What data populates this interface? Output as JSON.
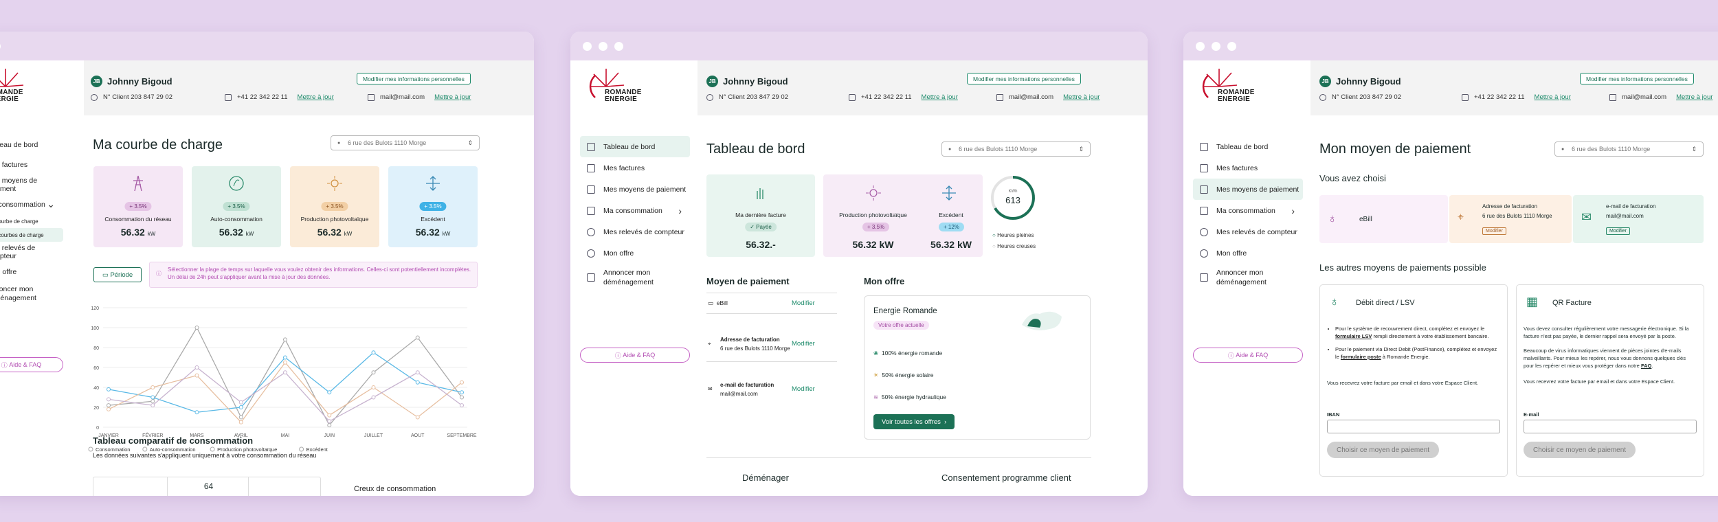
{
  "common": {
    "user_name": "Johnny Bigoud",
    "user_initials": "JB",
    "client_no": "N° Client 203 847 29 02",
    "phone": "+41 22 342 22 11",
    "email": "mail@mail.com",
    "update_link": "Mettre à jour",
    "edit_info": "Modifier mes informations personnelles",
    "address": "6 rue des Bulots 1110 Morge",
    "logo_line1": "ROMANDE",
    "logo_line2": "ENERGIE",
    "help": "Aide & FAQ",
    "accent": "#1c7156",
    "bg": "#e4d3ee"
  },
  "w1": {
    "nav": [
      "Tableau de bord",
      "Mes factures",
      "Mes moyens de paiement",
      "Ma consommation",
      "Ma courbe de charge",
      "Mes courbes de charge",
      "Mes relevés de compteur",
      "Mon offre",
      "Annoncer mon",
      "déménagement"
    ],
    "title": "Ma courbe de charge",
    "cards": [
      {
        "title": "Consommation du réseau",
        "badge": "+ 3.5%",
        "value": "56.32",
        "unit": "kW"
      },
      {
        "title": "Auto-consommation",
        "badge": "+ 3.5%",
        "value": "56.32",
        "unit": "kW"
      },
      {
        "title": "Production photovoltaïque",
        "badge": "+ 3.5%",
        "value": "56.32",
        "unit": "kW"
      },
      {
        "title": "Excédent",
        "badge": "+ 3.5%",
        "value": "56.32",
        "unit": "kW"
      }
    ],
    "period_btn": "Période",
    "period_notice": "Sélectionner la plage de temps sur laquelle vous voulez obtenir des informations. Celles-ci sont potentiellement incomplètes. Un délai de 24h peut s'appliquer avant la mise à jour des données.",
    "compare_title": "Tableau comparatif de consommation",
    "compare_sub": "Les données suivantes s'appliquent uniquement à votre consommation du réseau",
    "compare_value": "64",
    "creux": "Creux de consommation"
  },
  "chart_data": {
    "type": "line",
    "categories": [
      "JANVIER",
      "FÉVRIER",
      "MARS",
      "AVRIL",
      "MAI",
      "JUIN",
      "JUILLET",
      "AOUT",
      "SEPTEMBRE"
    ],
    "yticks": [
      "0",
      "20",
      "40",
      "60",
      "80",
      "100",
      "120"
    ],
    "ylim": [
      0,
      120
    ],
    "series": [
      {
        "name": "Consommation",
        "color": "#aaaaaa",
        "values": [
          22,
          26,
          100,
          10,
          88,
          2,
          55,
          90,
          30
        ]
      },
      {
        "name": "Auto-consommation",
        "color": "#5ab9e6",
        "values": [
          38,
          30,
          15,
          20,
          70,
          35,
          75,
          45,
          35
        ]
      },
      {
        "name": "Production photovoltaïque",
        "color": "#e7bfa0",
        "values": [
          18,
          40,
          52,
          5,
          65,
          12,
          40,
          10,
          45
        ]
      },
      {
        "name": "Excédent",
        "color": "#c7b3cf",
        "values": [
          28,
          22,
          60,
          25,
          55,
          6,
          30,
          55,
          22
        ]
      }
    ],
    "legend": "bottom"
  },
  "w2": {
    "nav": [
      "Tableau de bord",
      "Mes factures",
      "Mes moyens de paiement",
      "Ma consommation",
      "Mes relevés de compteur",
      "Mon offre",
      "Annoncer mon",
      "déménagement"
    ],
    "title": "Tableau de bord",
    "last_invoice": "Ma dernière facture",
    "paid": "Payée",
    "invoice_amount": "56.32.-",
    "pv": "Production photovoltaïque",
    "pv_badge": "+ 3.5%",
    "pv_value": "56.32 kW",
    "exc": "Excédent",
    "exc_badge": "+ 12%",
    "exc_value": "56.32 kW",
    "gauge_unit": "KWh",
    "gauge_value": "613",
    "peak": "Heures pleines",
    "offpeak": "Heures creuses",
    "payment_title": "Moyen de paiement",
    "ebill": "eBill",
    "modify": "Modifier",
    "billing_addr_label": "Adresse de facturation",
    "billing_addr": "6 rue des Bulots 1110 Morge",
    "email_label": "e-mail de facturation",
    "offer_title": "Mon offre",
    "offer_name": "Energie Romande",
    "current_offer": "Votre offre actuelle",
    "o1": "100% énergie romande",
    "o2": "50% énergie solaire",
    "o3": "50% énergie hydraulique",
    "all_offers": "Voir toutes les offres",
    "move": "Déménager",
    "consent": "Consentement programme client"
  },
  "w3": {
    "title": "Mon moyen de paiement",
    "chosen": "Vous avez choisi",
    "ebill": "eBill",
    "billing_addr_label": "Adresse de facturation",
    "billing_addr": "6 rue des Bulots 1110 Morge",
    "email_label": "e-mail de facturation",
    "modifier": "Modifier",
    "others": "Les autres moyens de paiements possible",
    "lsv_title": "Débit direct / LSV",
    "lsv_p1a": "Pour le système de recouvrement direct, complétez et envoyez le",
    "lsv_p1b": "formulaire LSV",
    "lsv_p1c": "rempli directement à votre établissement bancaire.",
    "lsv_p2a": "Pour le paiement via Direct Debit (PostFinance), complétez et envoyez le",
    "lsv_p2b": "formulaire poste",
    "lsv_p2c": "à Romande Energie.",
    "lsv_p3": "Vous recevrez votre facture par email et dans votre Espace Client.",
    "iban": "IBAN",
    "choose": "Choisir ce moyen de paiement",
    "qr_title": "QR Facture",
    "qr_p1": "Vous devez consulter régulièrement votre messagerie électronique. Si la facture n'est pas payée, le dernier rappel sera envoyé par la poste.",
    "qr_p2a": "Beaucoup de virus informatiques viennent de pièces jointes d'e-mails malveillants. Pour mieux les repérer, nous vous donnons quelques clés pour les repérer et mieux vous protéger dans notre",
    "qr_p2b": "FAQ",
    "qr_p3": "Vous recevrez votre facture par email et dans votre Espace Client.",
    "email": "E-mail"
  }
}
